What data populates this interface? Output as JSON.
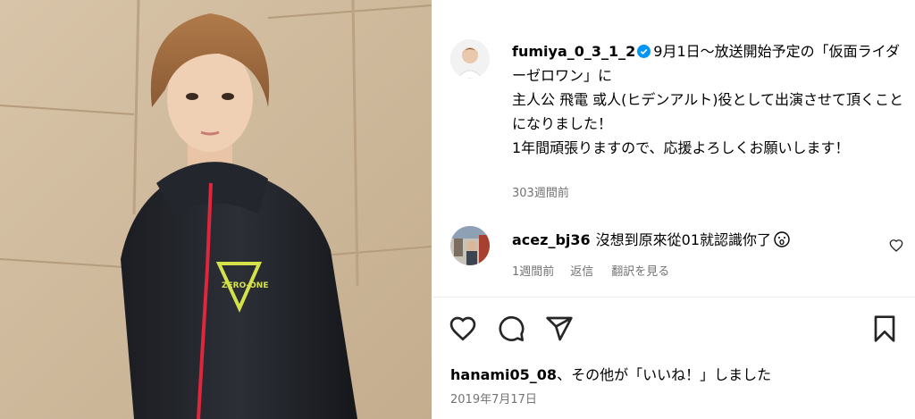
{
  "post": {
    "username": "fumiya_0_3_1_2",
    "verified": true,
    "caption": "9月1日〜放送開始予定の「仮面ライダーゼロワン」に\n主人公 飛電 或人(ヒデンアルト)役として出演させて頂くことになりました！\n1年間頑張りますので、応援よろしくお願いします！",
    "time_ago": "303週間前",
    "date": "2019年7月17日"
  },
  "comment": {
    "username": "acez_bj36",
    "text": "沒想到原來從01就認識你了",
    "emoji": "hushed-face-emoji",
    "time_ago": "1週間前",
    "reply_label": "返信",
    "translate_label": "翻訳を見る"
  },
  "likes": {
    "username": "hanami05_08",
    "text": "、その他が「いいね！」しました"
  },
  "icons": {
    "like": "heart-icon",
    "comment": "comment-bubble-icon",
    "share": "paper-plane-icon",
    "save": "bookmark-icon",
    "comment_like": "small-heart-icon",
    "verified": "verified-badge-icon"
  },
  "colors": {
    "verified": "#0095f6",
    "muted_text": "#737373",
    "divider": "#efefef",
    "jacket_zip": "#e0263a",
    "jacket_logo": "#d4e24a"
  }
}
